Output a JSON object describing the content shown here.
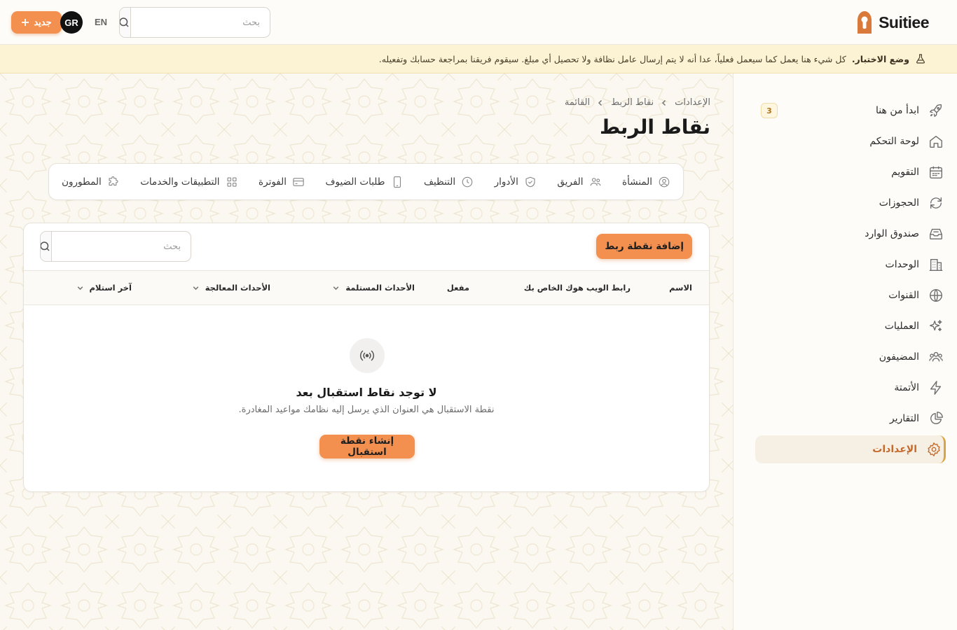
{
  "brand": {
    "name": "Suitiee",
    "accent_color": "#f3904f"
  },
  "header": {
    "search_placeholder": "بحث",
    "language": "EN",
    "avatar_initials": "GR",
    "new_button_label": "جديد",
    "new_button_icon": "plus-icon"
  },
  "banner": {
    "icon": "flask-icon",
    "title": "وضع الاختبار.",
    "message": "كل شيء هنا يعمل كما سيعمل فعلياً، عدا أنه لا يتم إرسال عامل نظافة ولا تحصيل أي مبلغ. سيقوم فريقنا بمراجعة حسابك وتفعيله."
  },
  "sidebar": {
    "items": [
      {
        "label": "ابدأ من هنا",
        "icon": "rocket-icon",
        "badge": "3"
      },
      {
        "label": "لوحة التحكم",
        "icon": "home-icon"
      },
      {
        "label": "التقويم",
        "icon": "calendar-icon"
      },
      {
        "label": "الحجوزات",
        "icon": "refresh-icon"
      },
      {
        "label": "صندوق الوارد",
        "icon": "inbox-icon"
      },
      {
        "label": "الوحدات",
        "icon": "building-icon"
      },
      {
        "label": "القنوات",
        "icon": "globe-icon"
      },
      {
        "label": "العمليات",
        "icon": "sparkles-icon"
      },
      {
        "label": "المضيفون",
        "icon": "users-icon"
      },
      {
        "label": "الأتمتة",
        "icon": "bolt-icon"
      },
      {
        "label": "التقارير",
        "icon": "pie-chart-icon"
      },
      {
        "label": "الإعدادات",
        "icon": "gear-icon",
        "active": true
      }
    ]
  },
  "breadcrumb": [
    "الإعدادات",
    "نقاط الربط",
    "القائمة"
  ],
  "page_title": "نقاط الربط",
  "tabs": [
    {
      "label": "المنشأة",
      "icon": "user-circle-icon"
    },
    {
      "label": "الفريق",
      "icon": "users-icon"
    },
    {
      "label": "الأدوار",
      "icon": "shield-icon"
    },
    {
      "label": "التنظيف",
      "icon": "clock-icon"
    },
    {
      "label": "طلبات الضيوف",
      "icon": "phone-icon"
    },
    {
      "label": "الفوترة",
      "icon": "credit-card-icon"
    },
    {
      "label": "التطبيقات والخدمات",
      "icon": "grid-icon"
    },
    {
      "label": "المطورون",
      "icon": "puzzle-icon"
    }
  ],
  "table": {
    "add_button": "إضافة نقطة ربط",
    "search_placeholder": "بحث",
    "columns": [
      {
        "label": "الاسم",
        "sortable": false
      },
      {
        "label": "رابط الويب هوك الخاص بك",
        "sortable": false
      },
      {
        "label": "مفعل",
        "sortable": false
      },
      {
        "label": "الأحداث المستلمة",
        "sortable": true
      },
      {
        "label": "الأحداث المعالجة",
        "sortable": true
      },
      {
        "label": "آخر استلام",
        "sortable": true
      }
    ],
    "empty": {
      "icon": "broadcast-icon",
      "title": "لا توجد نقاط استقبال بعد",
      "description": "نقطة الاستقبال هي العنوان الذي يرسل إليه نظامك مواعيد المغادرة.",
      "button": "إنشاء نقطة استقبال"
    }
  }
}
